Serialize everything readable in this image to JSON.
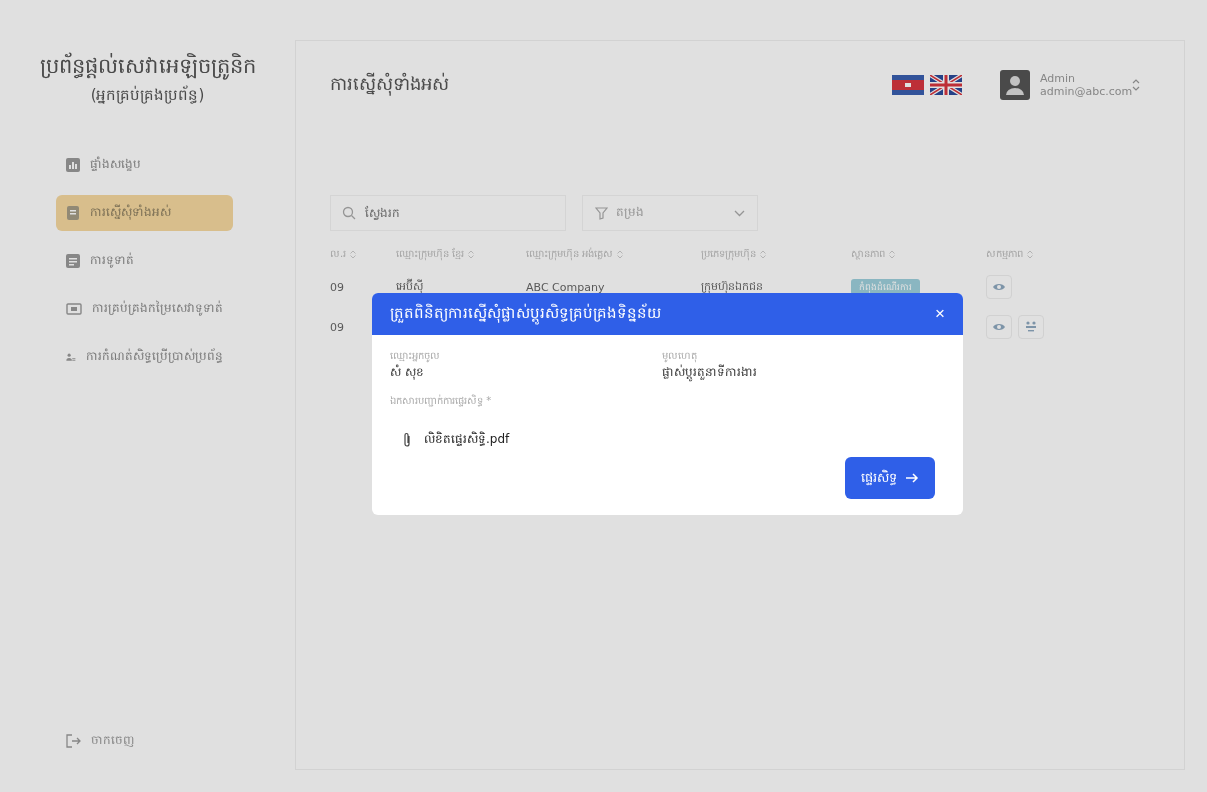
{
  "app": {
    "title": "ប្រព័ន្ធផ្តល់សេវាអេឡិចត្រូនិក",
    "subtitle": "(អ្នកគ្រប់គ្រងប្រព័ន្ធ)"
  },
  "sidebar": {
    "items": [
      {
        "label": "ផ្ទាំងសង្ខេប",
        "kind": "chart",
        "selected": false
      },
      {
        "label": "ការស្នើសុំទាំងអស់",
        "kind": "document",
        "selected": true
      },
      {
        "label": "ការទូទាត់",
        "kind": "list",
        "selected": false
      },
      {
        "label": "ការគ្រប់គ្រងកម្រៃសេវាទូទាត់",
        "kind": "card",
        "selected": false
      },
      {
        "label": "ការកំណត់សិទ្ធប្រើប្រាស់ប្រព័ន្ធ",
        "kind": "users",
        "selected": false
      }
    ],
    "logout": "ចាកចេញ"
  },
  "header": {
    "title": "ការស្នើសុំទាំងអស់",
    "user": {
      "name": "Admin",
      "email": "admin@abc.com"
    }
  },
  "search": {
    "placeholder": "ស្វែងរក"
  },
  "filter": {
    "placeholder": "តម្រង"
  },
  "table": {
    "columns": [
      "ល.រ",
      "ឈ្មោះក្រុមហ៊ុន ខ្មែរ",
      "ឈ្មោះក្រុមហ៊ុន អង់គ្លេស",
      "ប្រភេទក្រុមហ៊ុន",
      "ស្ថានភាព",
      "សកម្មភាព"
    ],
    "rows": [
      {
        "cells": [
          "09",
          "អេប៊ីស៊ី",
          "ABC Company",
          "ក្រុមហ៊ុនឯកជន"
        ],
        "status": "កំពុងដំណើរការ",
        "actions": [
          {
            "kind": "view"
          }
        ]
      },
      {
        "cells": [
          "09"
        ],
        "actions": [
          {
            "kind": "view"
          },
          {
            "kind": "transfer"
          }
        ]
      }
    ]
  },
  "modal": {
    "title": "ត្រួតពិនិត្យការស្នើសុំផ្លាស់ប្តូរសិទ្ធគ្រប់គ្រងទិន្នន័យ",
    "close": "×",
    "fields": [
      {
        "label": "ឈ្មោះអ្នកចូល",
        "value": "សំ សុខ"
      },
      {
        "label": "មូលហេតុ",
        "value": "ផ្លាស់ប្តូរតួនាទីការងារ"
      }
    ],
    "attachment_label": "ឯកសារបញ្ជាក់ការផ្ទេរសិទ្ធ",
    "required_mark": "*",
    "file": "លិខិតផ្ទេរសិទ្ធិ.pdf",
    "button": "ផ្ទេរសិទ្ធ"
  }
}
